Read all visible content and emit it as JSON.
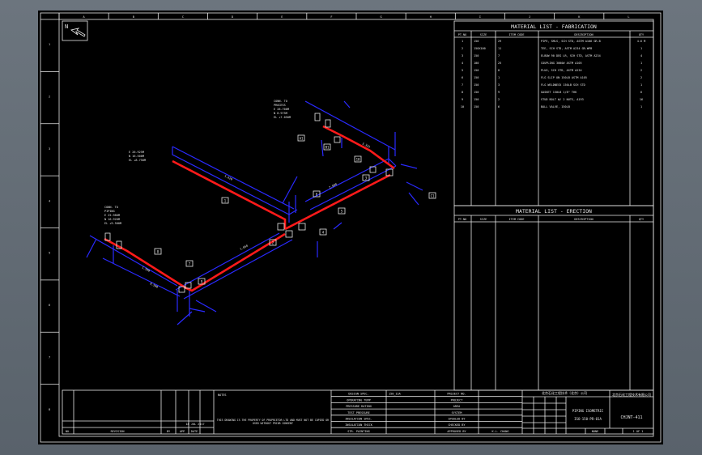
{
  "border": {
    "col_letters": [
      "A",
      "B",
      "C",
      "D",
      "E",
      "F",
      "G",
      "H",
      "I",
      "J",
      "K",
      "L"
    ],
    "row_numbers": [
      "1",
      "2",
      "3",
      "4",
      "5",
      "6",
      "7",
      "8"
    ]
  },
  "north_arrow": {
    "label": "N"
  },
  "fabrication": {
    "title": "MATERIAL LIST - FABRICATION",
    "headers": [
      "PT.NO",
      "SIZE",
      "ITEM CODE",
      "DESCRIPTION",
      "QTY"
    ],
    "rows": [
      [
        "1",
        "150",
        "29",
        "PIPE, SMLS, SCH STD, ASTM A106 GR.B",
        "4.6 M"
      ],
      [
        "2",
        "150X100",
        "11",
        "TEE, SCH STD, ASTM A234 GR.WPB",
        "1"
      ],
      [
        "3",
        "150",
        "7",
        "ELBOW 90 DEG LR, SCH STD, ASTM A234",
        "4"
      ],
      [
        "4",
        "100",
        "25",
        "COUPLING 3000# ASTM A105",
        "1"
      ],
      [
        "5",
        "150",
        "8",
        "PLUG, SCH STD, ASTM A234",
        "2"
      ],
      [
        "6",
        "150",
        "1",
        "FLG SLIP ON 150LB ASTM A105",
        "2"
      ],
      [
        "7",
        "150",
        "3",
        "FLG WELDNECK 150LB SCH STD",
        "1"
      ],
      [
        "8",
        "150",
        "9",
        "GASKET 150LB 1/8\" THK",
        "6"
      ],
      [
        "9",
        "150",
        "2",
        "STUD BOLT W/ 2 NUTS, A193",
        "16"
      ],
      [
        "10",
        "150",
        "6",
        "BALL VALVE, 150LB",
        "1"
      ]
    ]
  },
  "erection": {
    "title": "MATERIAL LIST - ERECTION",
    "headers": [
      "PT.NO",
      "SIZE",
      "ITEM CODE",
      "DESCRIPTION",
      "QTY"
    ]
  },
  "iso_labels": {
    "top_nozzle": [
      "CONN. TO",
      "PROCESS",
      "E 28.700M",
      "N 8.975M",
      "EL +7.050M"
    ],
    "left_nozzle": [
      "CONN. TO",
      "PIPING",
      "E 25.980M",
      "N 16.920M",
      "EL +9.500M"
    ],
    "upper_left_point": [
      "E 26.925M",
      "N 16.500M",
      "EL +8.750M"
    ],
    "dims": [
      "1.620",
      "1.050",
      "2.800",
      "3.325",
      "1.500",
      "0.500"
    ],
    "tags": [
      "1",
      "2",
      "3",
      "4",
      "5",
      "6",
      "7",
      "8",
      "9",
      "10",
      "A1",
      "B1",
      "C1"
    ]
  },
  "title_block": {
    "revision_headers": [
      "NO.",
      "REVISION",
      "BY",
      "APP",
      "DATE"
    ],
    "rev_date": "18 JUL 2017",
    "notes_label": "NOTES",
    "notes_text": "THIS DRAWING IS THE PROPERTY OF PROPRIETOR LTD AND MUST NOT BE COPIED OR USED WITHOUT PRIOR CONSENT",
    "design_data": [
      "DESIGN SPEC.",
      "OPERATING TEMP",
      "PRESSURE RATING",
      "TEST PRESSURE",
      "INSULATION SPEC.",
      "INSULATION THICK",
      "STR. PAINTING"
    ],
    "design_values": [
      "150_1SA",
      "",
      "",
      "",
      "",
      "",
      ""
    ],
    "project_labels": [
      "PROJECT NO.",
      "PROJECT",
      "AREA",
      "SYSTEM",
      "SPOOLED BY",
      "CHECKED BY",
      "APPROVED BY"
    ],
    "project_values": [
      "",
      "",
      "",
      "",
      "",
      "",
      "K.L. CHANG"
    ],
    "company_cn": "北京石化工程技术（北京）公司",
    "company_cn2": "北京石化工程技术有限公司",
    "drawing_title": "PIPING ISOMETRIC",
    "drawing_no": "ISO-150-PR-01A",
    "sheet_code": "CHJNT-411",
    "scale_label": "NONE",
    "sheet_label": "1 OF 1"
  }
}
